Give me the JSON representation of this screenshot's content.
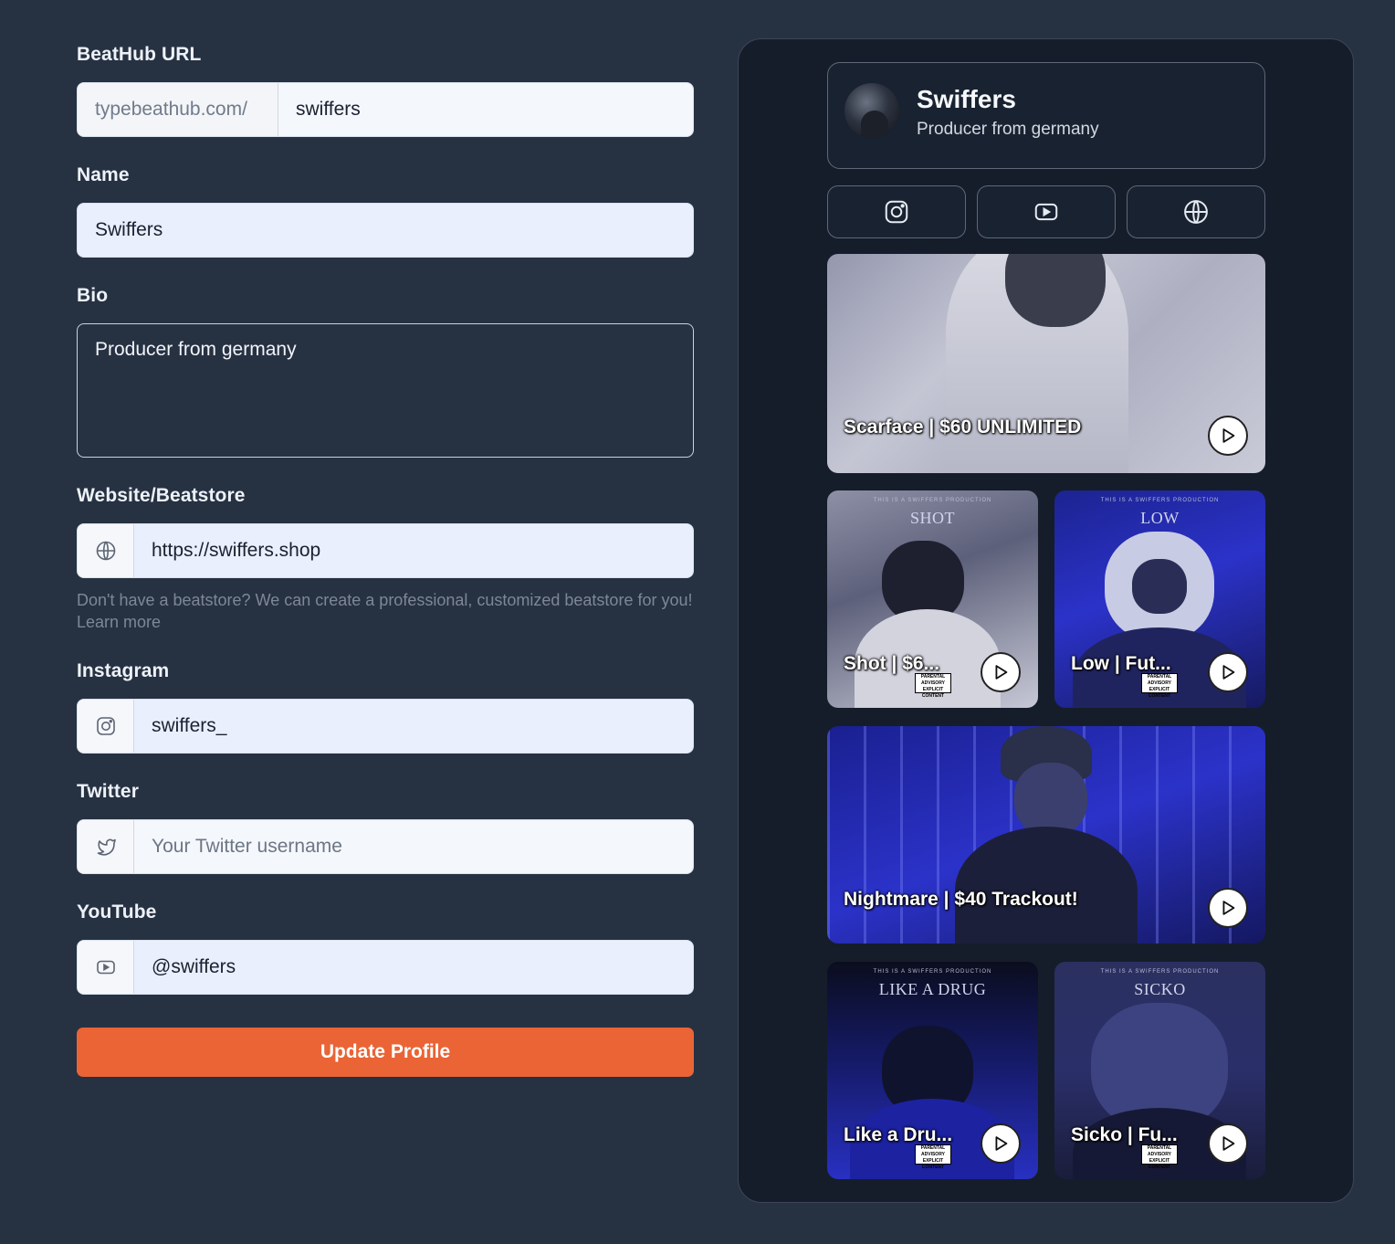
{
  "form": {
    "url_label": "BeatHub URL",
    "url_prefix": "typebeathub.com/",
    "url_value": "swiffers",
    "name_label": "Name",
    "name_value": "Swiffers",
    "bio_label": "Bio",
    "bio_value": "Producer from germany",
    "website_label": "Website/Beatstore",
    "website_value": "https://swiffers.shop",
    "website_help": "Don't have a beatstore? We can create a professional, customized beatstore for you! Learn more",
    "instagram_label": "Instagram",
    "instagram_value": "swiffers_",
    "twitter_label": "Twitter",
    "twitter_value": "",
    "twitter_placeholder": "Your Twitter username",
    "youtube_label": "YouTube",
    "youtube_value": "@swiffers",
    "update_label": "Update Profile"
  },
  "preview": {
    "name": "Swiffers",
    "bio": "Producer from germany",
    "social_icons": [
      "instagram-icon",
      "youtube-icon",
      "globe-icon"
    ],
    "beats": [
      {
        "title": "Scarface | $60 UNLIMITED"
      },
      {
        "title": "Shot | $6...",
        "cover_text": "SHOT"
      },
      {
        "title": "Low | Fut...",
        "cover_text": "LOW"
      },
      {
        "title": "Nightmare | $40 Trackout!"
      },
      {
        "title": "Like a Dru...",
        "cover_text": "LIKE A DRUG"
      },
      {
        "title": "Sicko | Fu...",
        "cover_text": "SICKO"
      }
    ],
    "cover_caption": "THIS IS A SWIFFERS PRODUCTION",
    "advisory_text": "PARENTAL ADVISORY EXPLICIT CONTENT"
  },
  "colors": {
    "background": "#263142",
    "accent": "#ea6435",
    "preview_bg": "#151d2a",
    "cover_blue": "#2b32c9"
  }
}
